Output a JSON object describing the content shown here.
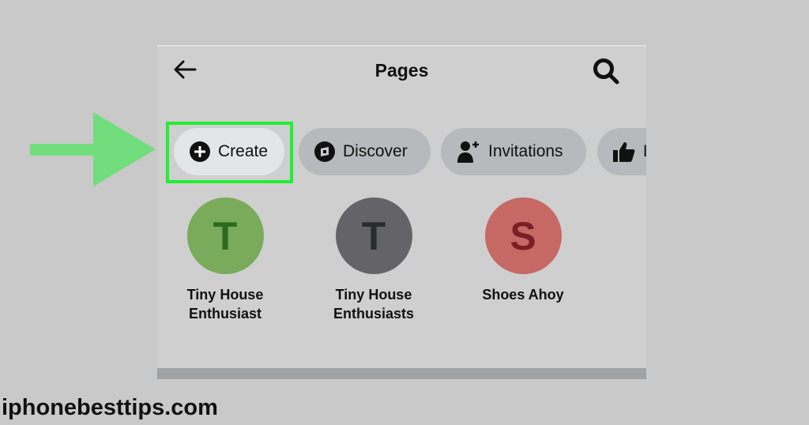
{
  "header": {
    "title": "Pages",
    "back_icon": "arrow-left-icon",
    "search_icon": "search-icon"
  },
  "chips": [
    {
      "label": "Create",
      "icon": "plus-circle-icon",
      "highlighted": true
    },
    {
      "label": "Discover",
      "icon": "compass-icon"
    },
    {
      "label": "Invitations",
      "icon": "person-add-icon"
    },
    {
      "label": "L",
      "icon": "thumbs-up-icon"
    }
  ],
  "pages": [
    {
      "initial": "T",
      "name_line1": "Tiny House",
      "name_line2": "Enthusiast",
      "color": "#7aab5a",
      "text_color": "#2d6a1e"
    },
    {
      "initial": "T",
      "name_line1": "Tiny House",
      "name_line2": "Enthusiasts",
      "color": "#646468",
      "text_color": "#2a2b2e"
    },
    {
      "initial": "S",
      "name_line1": "Shoes Ahoy",
      "name_line2": "",
      "color": "#c66864",
      "text_color": "#7a1f24"
    }
  ],
  "annotation": {
    "highlight_color": "#22ee33",
    "arrow_color": "#72dd7c"
  },
  "watermark": "iphonebesttips.com"
}
